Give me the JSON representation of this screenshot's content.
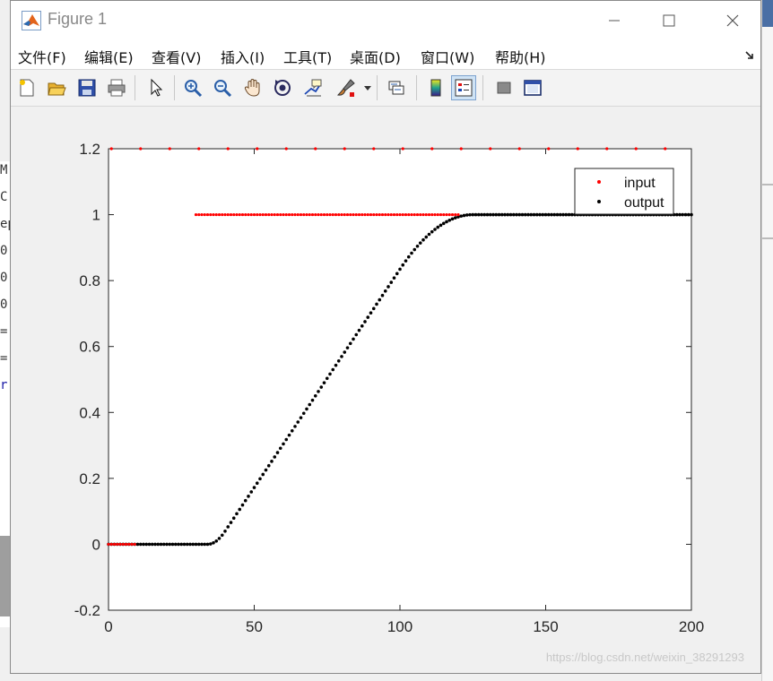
{
  "window": {
    "title": "Figure 1",
    "controls": {
      "minimize": "—",
      "maximize": "☐",
      "close": "✕"
    }
  },
  "menu": {
    "items": [
      "文件(F)",
      "编辑(E)",
      "查看(V)",
      "插入(I)",
      "工具(T)",
      "桌面(D)",
      "窗口(W)",
      "帮助(H)"
    ],
    "overflow_icon": "dock-arrow-icon"
  },
  "toolbar": {
    "icons": [
      "new-figure-icon",
      "open-file-icon",
      "save-icon",
      "print-icon",
      "edit-plot-pointer-icon",
      "zoom-in-icon",
      "zoom-out-icon",
      "pan-hand-icon",
      "rotate-3d-icon",
      "data-cursor-icon",
      "brush-icon",
      "link-plot-icon",
      "colorbar-icon",
      "legend-icon",
      "hide-plot-tools-icon",
      "show-plot-tools-icon"
    ]
  },
  "background": {
    "left_fragments": [
      "M",
      "C",
      "ep",
      "0",
      "0",
      "0",
      "=",
      "=",
      "r"
    ]
  },
  "chart_data": {
    "type": "scatter",
    "title": "",
    "xlabel": "",
    "ylabel": "",
    "xlim": [
      0,
      200
    ],
    "ylim": [
      -0.2,
      1.2
    ],
    "xticks": [
      "0",
      "50",
      "100",
      "150",
      "200"
    ],
    "yticks": [
      "-0.2",
      "0",
      "0.2",
      "0.4",
      "0.6",
      "0.8",
      "1",
      "1.2"
    ],
    "grid": false,
    "legend_position": "top-right",
    "colors": {
      "input": "#ff0000",
      "output": "#000000"
    },
    "series": [
      {
        "name": "input",
        "segments": [
          {
            "x_from": 0,
            "x_to": 9,
            "step": 1,
            "y": 0
          },
          {
            "x_from": 30,
            "x_to": 120,
            "step": 1,
            "y": 1
          },
          {
            "x_from": 1,
            "x_to": 191,
            "step": 10,
            "y": 1.2
          }
        ]
      },
      {
        "name": "output",
        "curve": "s-curve",
        "x_from": 0,
        "x_to": 200,
        "step": 1,
        "y_before": 0,
        "rise_start": 34,
        "linear_start": 40,
        "linear_end": 100,
        "settle_end": 125,
        "y_after": 1
      }
    ]
  },
  "watermark": "https://blog.csdn.net/weixin_38291293"
}
